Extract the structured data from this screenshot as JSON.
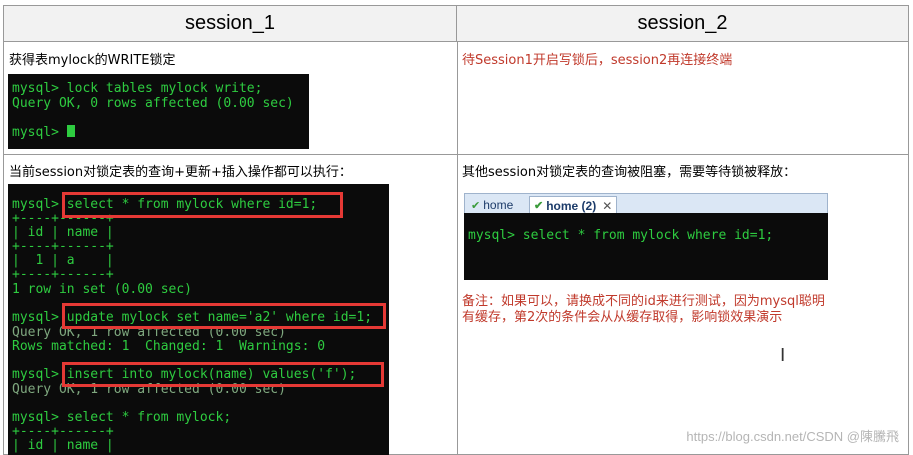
{
  "headers": {
    "s1": "session_1",
    "s2": "session_2"
  },
  "row1": {
    "left_text": "获得表mylock的WRITE锁定",
    "right_text": "待Session1开启写锁后，session2再连接终端",
    "terminal": [
      "mysql> lock tables mylock write;",
      "Query OK, 0 rows affected (0.00 sec)",
      "mysql> "
    ]
  },
  "row2": {
    "left_text": "当前session对锁定表的查询+更新+插入操作都可以执行：",
    "right_text": "其他session对锁定表的查询被阻塞，需要等待锁被释放：",
    "left_terminal": [
      "mysql> select * from mylock where id=1;",
      "+----+------+",
      "| id | name |",
      "+----+------+",
      "|  1 | a    |",
      "+----+------+",
      "1 row in set (0.00 sec)",
      "mysql> update mylock set name='a2' where id=1;",
      "Query OK, 1 row affected (0.00 sec)",
      "Rows matched: 1  Changed: 1  Warnings: 0",
      "mysql> insert into mylock(name) values('f');",
      "Query OK, 1 row affected (0.00 sec)",
      "mysql> select * from mylock;",
      "+----+------+",
      "| id | name |"
    ],
    "tabs": [
      "home",
      "home (2)"
    ],
    "right_terminal": "mysql> select * from mylock where id=1;",
    "note_line1": "备注：如果可以，请换成不同的id来进行测试，因为mysql聪明",
    "note_line2": "有缓存，第2次的条件会从从缓存取得，影响锁效果演示"
  },
  "watermark": "https://blog.csdn.net/CSDN @陳騰飛"
}
